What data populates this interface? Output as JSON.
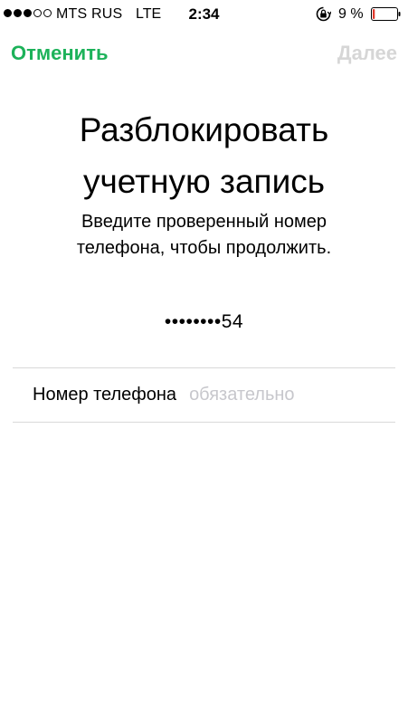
{
  "status_bar": {
    "signal_strength": 3,
    "signal_max": 5,
    "carrier": "MTS RUS",
    "network": "LTE",
    "time": "2:34",
    "battery_percent": "9 %",
    "battery_level": 0.09
  },
  "nav": {
    "cancel_label": "Отменить",
    "next_label": "Далее"
  },
  "content": {
    "title": "Разблокировать учетную запись",
    "subtitle": "Введите проверенный номер телефона, чтобы продолжить.",
    "masked_phone": "••••••••54"
  },
  "form": {
    "phone_label": "Номер телефона",
    "phone_placeholder": "обязательно",
    "phone_value": ""
  },
  "colors": {
    "accent": "#1db25a",
    "disabled": "#d6d6d6",
    "placeholder": "#c7c7cc",
    "divider": "#d9d9d9"
  }
}
